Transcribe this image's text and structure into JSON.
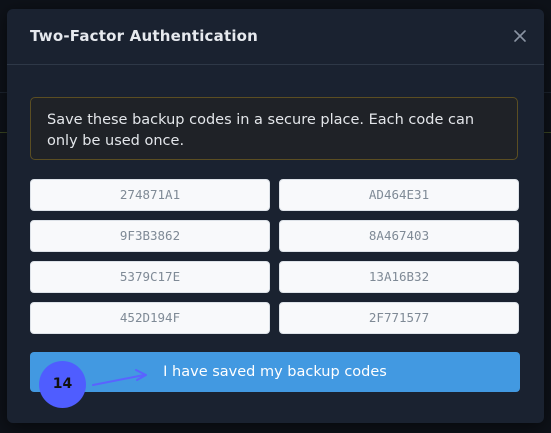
{
  "modal": {
    "title": "Two-Factor Authentication",
    "close_icon": "close-icon"
  },
  "alert": {
    "message": "Save these backup codes in a secure place. Each code can only be used once."
  },
  "backup_codes": [
    "274871A1",
    "AD464E31",
    "9F3B3862",
    "8A467403",
    "5379C17E",
    "13A16B32",
    "452D194F",
    "2F771577"
  ],
  "confirm_button": {
    "label": "I have saved my backup codes"
  },
  "annotation": {
    "step_number": "14",
    "marker_color": "#4f5dff"
  },
  "colors": {
    "accent": "#4299e1",
    "alert_border": "#5b4e22",
    "modal_bg": "#1a2230"
  }
}
